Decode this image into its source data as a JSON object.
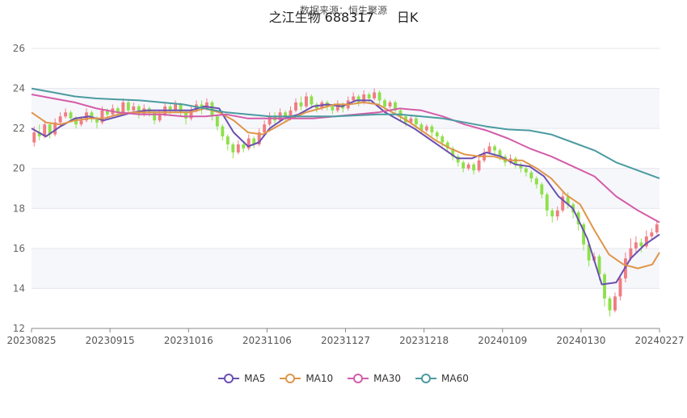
{
  "chart_data": {
    "type": "candlestick",
    "title": "之江生物 688317",
    "title_suffix": "日K",
    "subtitle": "数据来源：恒生聚源",
    "ylim": [
      12,
      26
    ],
    "yticks": [
      12,
      14,
      16,
      18,
      20,
      22,
      24,
      26
    ],
    "xticks": [
      "20230825",
      "20230915",
      "20231016",
      "20231106",
      "20231127",
      "20231218",
      "20240109",
      "20240130",
      "20240227"
    ],
    "grid": true,
    "legend_position": "bottom",
    "up_color": "#f07c82",
    "down_color": "#8ee04a",
    "series": [
      {
        "name": "MA5",
        "color": "#6b4fb0",
        "points": [
          [
            0,
            22.0
          ],
          [
            4,
            21.6
          ],
          [
            8,
            22.1
          ],
          [
            12,
            22.5
          ],
          [
            16,
            22.6
          ],
          [
            20,
            22.4
          ],
          [
            24,
            22.6
          ],
          [
            28,
            22.8
          ],
          [
            32,
            22.9
          ],
          [
            36,
            22.9
          ],
          [
            40,
            22.9
          ],
          [
            44,
            22.9
          ],
          [
            48,
            23.1
          ],
          [
            52,
            23.0
          ],
          [
            56,
            21.8
          ],
          [
            60,
            21.1
          ],
          [
            63,
            21.3
          ],
          [
            66,
            22.0
          ],
          [
            70,
            22.5
          ],
          [
            74,
            22.7
          ],
          [
            78,
            23.1
          ],
          [
            82,
            23.2
          ],
          [
            86,
            23.1
          ],
          [
            90,
            23.4
          ],
          [
            94,
            23.4
          ],
          [
            98,
            22.8
          ],
          [
            102,
            22.4
          ],
          [
            106,
            22.0
          ],
          [
            110,
            21.5
          ],
          [
            114,
            21.0
          ],
          [
            118,
            20.5
          ],
          [
            122,
            20.5
          ],
          [
            126,
            20.8
          ],
          [
            130,
            20.6
          ],
          [
            134,
            20.2
          ],
          [
            138,
            20.1
          ],
          [
            142,
            19.6
          ],
          [
            146,
            18.6
          ],
          [
            150,
            18.0
          ],
          [
            154,
            16.5
          ],
          [
            158,
            14.2
          ],
          [
            162,
            14.3
          ],
          [
            166,
            15.5
          ],
          [
            170,
            16.2
          ],
          [
            174,
            16.7
          ]
        ]
      },
      {
        "name": "MA10",
        "color": "#e0954a",
        "points": [
          [
            0,
            22.8
          ],
          [
            4,
            22.3
          ],
          [
            8,
            22.2
          ],
          [
            12,
            22.4
          ],
          [
            16,
            22.5
          ],
          [
            20,
            22.5
          ],
          [
            24,
            22.7
          ],
          [
            28,
            22.8
          ],
          [
            32,
            22.8
          ],
          [
            36,
            22.8
          ],
          [
            40,
            22.8
          ],
          [
            44,
            22.8
          ],
          [
            48,
            23.0
          ],
          [
            52,
            22.8
          ],
          [
            56,
            22.4
          ],
          [
            60,
            21.8
          ],
          [
            64,
            21.7
          ],
          [
            68,
            22.1
          ],
          [
            72,
            22.5
          ],
          [
            76,
            22.8
          ],
          [
            80,
            23.0
          ],
          [
            84,
            23.2
          ],
          [
            88,
            23.2
          ],
          [
            92,
            23.3
          ],
          [
            96,
            23.2
          ],
          [
            100,
            22.8
          ],
          [
            104,
            22.4
          ],
          [
            108,
            21.9
          ],
          [
            112,
            21.4
          ],
          [
            116,
            21.0
          ],
          [
            120,
            20.7
          ],
          [
            124,
            20.6
          ],
          [
            128,
            20.6
          ],
          [
            132,
            20.4
          ],
          [
            136,
            20.4
          ],
          [
            140,
            20.0
          ],
          [
            144,
            19.5
          ],
          [
            148,
            18.7
          ],
          [
            152,
            18.2
          ],
          [
            156,
            16.9
          ],
          [
            160,
            15.7
          ],
          [
            164,
            15.2
          ],
          [
            168,
            15.0
          ],
          [
            172,
            15.2
          ],
          [
            174,
            15.8
          ]
        ]
      },
      {
        "name": "MA30",
        "color": "#d45ca8",
        "points": [
          [
            0,
            23.7
          ],
          [
            6,
            23.5
          ],
          [
            12,
            23.3
          ],
          [
            18,
            23.0
          ],
          [
            24,
            22.8
          ],
          [
            30,
            22.7
          ],
          [
            36,
            22.7
          ],
          [
            42,
            22.6
          ],
          [
            48,
            22.6
          ],
          [
            54,
            22.7
          ],
          [
            60,
            22.5
          ],
          [
            66,
            22.5
          ],
          [
            72,
            22.5
          ],
          [
            78,
            22.5
          ],
          [
            84,
            22.6
          ],
          [
            90,
            22.7
          ],
          [
            96,
            22.8
          ],
          [
            102,
            23.0
          ],
          [
            108,
            22.9
          ],
          [
            114,
            22.6
          ],
          [
            120,
            22.2
          ],
          [
            126,
            21.9
          ],
          [
            132,
            21.5
          ],
          [
            138,
            21.0
          ],
          [
            144,
            20.6
          ],
          [
            150,
            20.1
          ],
          [
            156,
            19.6
          ],
          [
            162,
            18.6
          ],
          [
            168,
            17.9
          ],
          [
            174,
            17.3
          ]
        ]
      },
      {
        "name": "MA60",
        "color": "#4a9ba0",
        "points": [
          [
            0,
            24.0
          ],
          [
            6,
            23.8
          ],
          [
            12,
            23.6
          ],
          [
            18,
            23.5
          ],
          [
            24,
            23.45
          ],
          [
            30,
            23.4
          ],
          [
            36,
            23.3
          ],
          [
            42,
            23.2
          ],
          [
            48,
            23.0
          ],
          [
            54,
            22.8
          ],
          [
            60,
            22.7
          ],
          [
            66,
            22.6
          ],
          [
            72,
            22.6
          ],
          [
            78,
            22.6
          ],
          [
            84,
            22.6
          ],
          [
            90,
            22.65
          ],
          [
            96,
            22.7
          ],
          [
            102,
            22.7
          ],
          [
            108,
            22.6
          ],
          [
            114,
            22.5
          ],
          [
            120,
            22.3
          ],
          [
            126,
            22.1
          ],
          [
            132,
            21.95
          ],
          [
            138,
            21.9
          ],
          [
            144,
            21.7
          ],
          [
            150,
            21.3
          ],
          [
            156,
            20.9
          ],
          [
            162,
            20.3
          ],
          [
            168,
            19.9
          ],
          [
            174,
            19.5
          ]
        ]
      }
    ],
    "candles": [
      [
        21.3,
        21.8,
        21.1,
        22.1
      ],
      [
        21.8,
        21.6,
        21.4,
        22.2
      ],
      [
        21.6,
        22.2,
        21.5,
        22.4
      ],
      [
        22.2,
        21.7,
        21.5,
        22.3
      ],
      [
        21.7,
        22.3,
        21.6,
        22.5
      ],
      [
        22.3,
        22.6,
        22.1,
        22.8
      ],
      [
        22.6,
        22.8,
        22.5,
        23.0
      ],
      [
        22.8,
        22.5,
        22.3,
        22.9
      ],
      [
        22.5,
        22.2,
        22.0,
        22.6
      ],
      [
        22.2,
        22.4,
        22.1,
        22.6
      ],
      [
        22.4,
        22.8,
        22.3,
        23.0
      ],
      [
        22.8,
        22.5,
        22.3,
        22.9
      ],
      [
        22.5,
        22.3,
        22.0,
        22.6
      ],
      [
        22.3,
        22.9,
        22.2,
        23.1
      ],
      [
        22.9,
        22.7,
        22.5,
        23.0
      ],
      [
        22.7,
        23.0,
        22.6,
        23.2
      ],
      [
        23.0,
        22.8,
        22.6,
        23.1
      ],
      [
        22.8,
        23.3,
        22.7,
        23.5
      ],
      [
        23.3,
        22.9,
        22.8,
        23.4
      ],
      [
        22.9,
        23.1,
        22.8,
        23.3
      ],
      [
        23.1,
        22.7,
        22.5,
        23.2
      ],
      [
        22.7,
        23.0,
        22.6,
        23.2
      ],
      [
        23.0,
        22.8,
        22.6,
        23.1
      ],
      [
        22.8,
        22.4,
        22.2,
        22.9
      ],
      [
        22.4,
        22.7,
        22.3,
        22.9
      ],
      [
        22.7,
        23.1,
        22.6,
        23.3
      ],
      [
        23.1,
        22.9,
        22.7,
        23.2
      ],
      [
        22.9,
        23.2,
        22.8,
        23.4
      ],
      [
        23.2,
        22.8,
        22.6,
        23.3
      ],
      [
        22.8,
        22.5,
        22.2,
        22.9
      ],
      [
        22.5,
        22.9,
        22.4,
        23.1
      ],
      [
        22.9,
        23.2,
        22.8,
        23.4
      ],
      [
        23.2,
        23.0,
        22.7,
        23.4
      ],
      [
        23.0,
        23.3,
        22.9,
        23.5
      ],
      [
        23.3,
        22.6,
        22.4,
        23.4
      ],
      [
        22.6,
        22.1,
        21.9,
        22.7
      ],
      [
        22.1,
        21.6,
        21.4,
        22.2
      ],
      [
        21.6,
        21.2,
        20.9,
        21.7
      ],
      [
        21.2,
        20.8,
        20.5,
        21.3
      ],
      [
        20.8,
        21.2,
        20.7,
        21.4
      ],
      [
        21.2,
        21.0,
        20.8,
        21.3
      ],
      [
        21.0,
        21.5,
        20.9,
        21.7
      ],
      [
        21.5,
        21.2,
        21.0,
        21.6
      ],
      [
        21.2,
        21.8,
        21.1,
        22.0
      ],
      [
        21.8,
        22.2,
        21.7,
        22.4
      ],
      [
        22.2,
        22.6,
        22.1,
        22.8
      ],
      [
        22.6,
        22.4,
        22.2,
        22.8
      ],
      [
        22.4,
        22.8,
        22.3,
        23.0
      ],
      [
        22.8,
        22.5,
        22.3,
        22.9
      ],
      [
        22.5,
        22.9,
        22.4,
        23.1
      ],
      [
        22.9,
        23.3,
        22.8,
        23.5
      ],
      [
        23.3,
        23.1,
        22.9,
        23.6
      ],
      [
        23.1,
        23.6,
        23.0,
        23.8
      ],
      [
        23.6,
        23.2,
        23.0,
        23.7
      ],
      [
        23.2,
        23.0,
        22.8,
        23.3
      ],
      [
        23.0,
        23.3,
        22.9,
        23.4
      ],
      [
        23.3,
        23.1,
        22.9,
        23.4
      ],
      [
        23.1,
        22.9,
        22.7,
        23.2
      ],
      [
        22.9,
        23.2,
        22.8,
        23.4
      ],
      [
        23.2,
        23.0,
        22.8,
        23.3
      ],
      [
        23.0,
        23.4,
        22.9,
        23.6
      ],
      [
        23.4,
        23.6,
        23.3,
        23.8
      ],
      [
        23.6,
        23.3,
        23.1,
        23.7
      ],
      [
        23.3,
        23.7,
        23.2,
        23.9
      ],
      [
        23.7,
        23.5,
        23.3,
        23.8
      ],
      [
        23.5,
        23.8,
        23.4,
        24.0
      ],
      [
        23.8,
        23.4,
        23.2,
        23.9
      ],
      [
        23.4,
        23.1,
        22.9,
        23.5
      ],
      [
        23.1,
        23.3,
        23.0,
        23.4
      ],
      [
        23.3,
        22.9,
        22.7,
        23.4
      ],
      [
        22.9,
        22.6,
        22.4,
        23.0
      ],
      [
        22.6,
        22.3,
        22.1,
        22.7
      ],
      [
        22.3,
        22.5,
        22.2,
        22.6
      ],
      [
        22.5,
        22.2,
        22.0,
        22.6
      ],
      [
        22.2,
        21.9,
        21.7,
        22.3
      ],
      [
        21.9,
        22.1,
        21.8,
        22.2
      ],
      [
        22.1,
        21.8,
        21.6,
        22.2
      ],
      [
        21.8,
        21.6,
        21.4,
        21.9
      ],
      [
        21.6,
        21.3,
        21.1,
        21.7
      ],
      [
        21.3,
        21.0,
        20.8,
        21.4
      ],
      [
        21.0,
        20.6,
        20.4,
        21.1
      ],
      [
        20.6,
        20.3,
        20.1,
        20.7
      ],
      [
        20.3,
        20.0,
        19.8,
        20.4
      ],
      [
        20.0,
        20.2,
        19.9,
        20.3
      ],
      [
        20.2,
        19.9,
        19.7,
        20.3
      ],
      [
        19.9,
        20.4,
        19.8,
        20.6
      ],
      [
        20.4,
        20.8,
        20.3,
        21.0
      ],
      [
        20.8,
        21.1,
        20.7,
        21.3
      ],
      [
        21.1,
        20.9,
        20.7,
        21.2
      ],
      [
        20.9,
        20.6,
        20.4,
        21.0
      ],
      [
        20.6,
        20.3,
        20.1,
        20.7
      ],
      [
        20.3,
        20.5,
        20.2,
        20.7
      ],
      [
        20.5,
        20.2,
        20.0,
        20.6
      ],
      [
        20.2,
        20.0,
        19.8,
        20.3
      ],
      [
        20.0,
        19.8,
        19.6,
        20.1
      ],
      [
        19.8,
        19.5,
        19.3,
        19.9
      ],
      [
        19.5,
        19.2,
        19.0,
        19.6
      ],
      [
        19.2,
        18.7,
        18.5,
        19.3
      ],
      [
        18.7,
        17.9,
        17.6,
        18.8
      ],
      [
        17.9,
        17.6,
        17.3,
        18.0
      ],
      [
        17.6,
        17.9,
        17.4,
        18.1
      ],
      [
        17.9,
        18.6,
        17.8,
        18.8
      ],
      [
        18.6,
        18.2,
        18.0,
        18.8
      ],
      [
        18.2,
        17.8,
        17.5,
        18.3
      ],
      [
        17.8,
        17.2,
        16.9,
        17.9
      ],
      [
        17.2,
        16.2,
        15.9,
        17.3
      ],
      [
        16.2,
        15.4,
        15.1,
        16.3
      ],
      [
        15.4,
        15.6,
        15.3,
        15.8
      ],
      [
        15.6,
        14.7,
        14.4,
        15.7
      ],
      [
        14.7,
        13.5,
        13.1,
        14.8
      ],
      [
        13.5,
        12.9,
        12.6,
        13.6
      ],
      [
        12.9,
        13.6,
        12.8,
        13.8
      ],
      [
        13.6,
        14.5,
        13.4,
        14.7
      ],
      [
        14.5,
        15.5,
        14.3,
        15.8
      ],
      [
        15.5,
        16.0,
        15.4,
        16.5
      ],
      [
        16.0,
        16.3,
        15.8,
        16.6
      ],
      [
        16.3,
        16.1,
        15.8,
        16.5
      ],
      [
        16.1,
        16.6,
        16.0,
        16.9
      ],
      [
        16.6,
        16.8,
        16.4,
        17.0
      ],
      [
        16.8,
        17.2,
        16.7,
        17.4
      ]
    ]
  }
}
